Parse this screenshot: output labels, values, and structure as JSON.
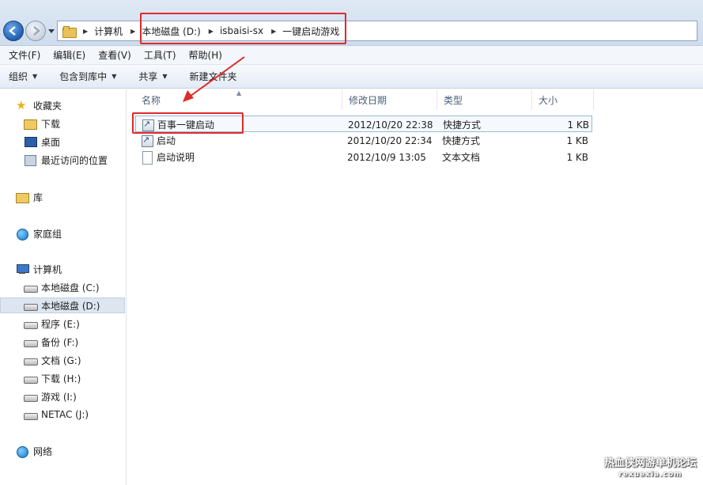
{
  "address_bar": {
    "crumbs": [
      "计算机",
      "本地磁盘 (D:)",
      "isbaisi-sx",
      "一键启动游戏"
    ]
  },
  "menu": [
    "文件(F)",
    "编辑(E)",
    "查看(V)",
    "工具(T)",
    "帮助(H)"
  ],
  "toolbar": {
    "organize": "组织",
    "include_library": "包含到库中",
    "share": "共享",
    "new_folder": "新建文件夹"
  },
  "nav": {
    "favorites": "收藏夹",
    "downloads": "下载",
    "desktop": "桌面",
    "recent": "最近访问的位置",
    "libraries": "库",
    "homegroup": "家庭组",
    "computer": "计算机",
    "drives": [
      "本地磁盘 (C:)",
      "本地磁盘 (D:)",
      "程序 (E:)",
      "备份 (F:)",
      "文档 (G:)",
      "下载 (H:)",
      "游戏 (I:)",
      "NETAC (J:)"
    ],
    "network": "网络"
  },
  "columns": {
    "name": "名称",
    "modified": "修改日期",
    "type": "类型",
    "size": "大小"
  },
  "files": [
    {
      "name": "百事一键启动",
      "modified": "2012/10/20 22:38",
      "type": "快捷方式",
      "size": "1 KB"
    },
    {
      "name": "启动",
      "modified": "2012/10/20 22:34",
      "type": "快捷方式",
      "size": "1 KB"
    },
    {
      "name": "启动说明",
      "modified": "2012/10/9 13:05",
      "type": "文本文档",
      "size": "1 KB"
    }
  ],
  "watermark": {
    "line1": "热血侠网游单机论坛",
    "line2": "rexuexia.com"
  },
  "colors": {
    "highlight_red": "#e02a2a"
  }
}
